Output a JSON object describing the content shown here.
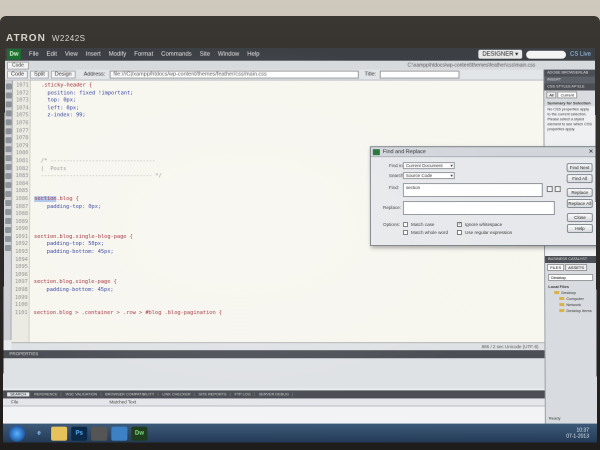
{
  "monitor": {
    "brand": "ATRON",
    "model": "W2242S"
  },
  "menubar": {
    "logo": "Dw",
    "items": [
      "File",
      "Edit",
      "View",
      "Insert",
      "Modify",
      "Format",
      "Commands",
      "Site",
      "Window",
      "Help"
    ],
    "workspace": "DESIGNER ▾",
    "cs_live": "CS Live"
  },
  "docbar": {
    "tab": "Code",
    "path": "C:\\xampp\\htdocs\\wp-content\\themes\\feather\\css\\main.css"
  },
  "toolbar": {
    "code_label": "Code",
    "split_label": "Split",
    "design_label": "Design",
    "address_label": "Address:",
    "address_value": "file:///C|/xampp/htdocs/wp-content/themes/feather/css/main.css",
    "title_label": "Title:"
  },
  "editor": {
    "lines": [
      {
        "n": "1071",
        "t": "  .sticky-header {",
        "k": "sel"
      },
      {
        "n": "1072",
        "t": "    position: fixed !important;",
        "k": "prop"
      },
      {
        "n": "1073",
        "t": "    top: 0px;",
        "k": "prop"
      },
      {
        "n": "1074",
        "t": "    left: 0px;",
        "k": "prop"
      },
      {
        "n": "1075",
        "t": "    z-index: 99;",
        "k": "prop"
      },
      {
        "n": "1076",
        "t": "",
        "k": "prop"
      },
      {
        "n": "1077",
        "t": "",
        "k": "prop"
      },
      {
        "n": "1078",
        "t": "",
        "k": "prop"
      },
      {
        "n": "1079",
        "t": "",
        "k": "prop"
      },
      {
        "n": "1080",
        "t": "",
        "k": "prop"
      },
      {
        "n": "1081",
        "t": "  /* ---------------------------------",
        "k": "comment"
      },
      {
        "n": "1082",
        "t": "  |  Posts",
        "k": "comment"
      },
      {
        "n": "1083",
        "t": "  ----------------------------------- */",
        "k": "comment"
      },
      {
        "n": "1084",
        "t": "",
        "k": "prop"
      },
      {
        "n": "1085",
        "t": "",
        "k": "prop"
      },
      {
        "n": "1086",
        "t": "section.blog {",
        "k": "hl",
        "h": "section"
      },
      {
        "n": "1087",
        "t": "    padding-top: 0px;",
        "k": "prop"
      },
      {
        "n": "1088",
        "t": "",
        "k": "prop"
      },
      {
        "n": "1089",
        "t": "",
        "k": "prop"
      },
      {
        "n": "1090",
        "t": "",
        "k": "prop"
      },
      {
        "n": "1091",
        "t": "section.blog.single-blog-page {",
        "k": "sel"
      },
      {
        "n": "1092",
        "t": "    padding-top: 50px;",
        "k": "prop"
      },
      {
        "n": "1093",
        "t": "    padding-bottom: 45px;",
        "k": "prop"
      },
      {
        "n": "1094",
        "t": "",
        "k": "prop"
      },
      {
        "n": "1095",
        "t": "",
        "k": "prop"
      },
      {
        "n": "1096",
        "t": "",
        "k": "prop"
      },
      {
        "n": "1097",
        "t": "section.blog.single-page {",
        "k": "sel"
      },
      {
        "n": "1098",
        "t": "    padding-bottom: 45px;",
        "k": "prop"
      },
      {
        "n": "1099",
        "t": "",
        "k": "prop"
      },
      {
        "n": "1100",
        "t": "",
        "k": "prop"
      },
      {
        "n": "1101",
        "t": "section.blog > .container > .row > #blog .blog-pagination {",
        "k": "sel"
      }
    ],
    "status": "886 / 2 sec  Unicode (UTF-8)"
  },
  "properties": {
    "header": "PROPERTIES"
  },
  "results": {
    "tabs": [
      "SEARCH",
      "REFERENCE",
      "W3C VALIDATION",
      "BROWSER COMPATIBILITY",
      "LINK CHECKER",
      "SITE REPORTS",
      "FTP LOG",
      "SERVER DEBUG"
    ],
    "col_file": "File",
    "col_text": "Matched Text"
  },
  "find_replace": {
    "title": "Find and Replace",
    "find_in_label": "Find in:",
    "find_in_value": "Current Document",
    "search_label": "Search:",
    "search_value": "Source Code",
    "find_label": "Find:",
    "find_value": "section",
    "replace_label": "Replace:",
    "replace_value": "",
    "options_label": "Options:",
    "match_case": "Match case",
    "match_whole_word": "Match whole word",
    "ignore_whitespace": "Ignore whitespace",
    "use_regex": "Use regular expression",
    "buttons": {
      "find_next": "Find Next",
      "find_all": "Find All",
      "replace": "Replace",
      "replace_all": "Replace All",
      "close": "Close",
      "help": "Help"
    }
  },
  "right_panel": {
    "insert_header": "ADOBE BROWSERLAB",
    "insert_tab": "INSERT",
    "css_header": "CSS STYLES",
    "css_header2": "AP ELE",
    "tab_all": "All",
    "tab_current": "Current",
    "summary": "Summary for Selection",
    "note": "No CSS properties apply to the current selection. Please select a styled element to see which CSS properties apply.",
    "business_catalyst": "BUSINESS CATALYST",
    "files_tab": "FILES",
    "assets_tab": "ASSETS",
    "files_select": "Desktop",
    "local_files": "Local Files",
    "tree": [
      "Desktop",
      "Computer",
      "Network",
      "Desktop items"
    ],
    "ready": "Ready"
  },
  "taskbar": {
    "apps": [
      "e",
      "",
      "Ps",
      "",
      "",
      "Dw"
    ],
    "time": "10:37",
    "date": "07-1-2013"
  }
}
